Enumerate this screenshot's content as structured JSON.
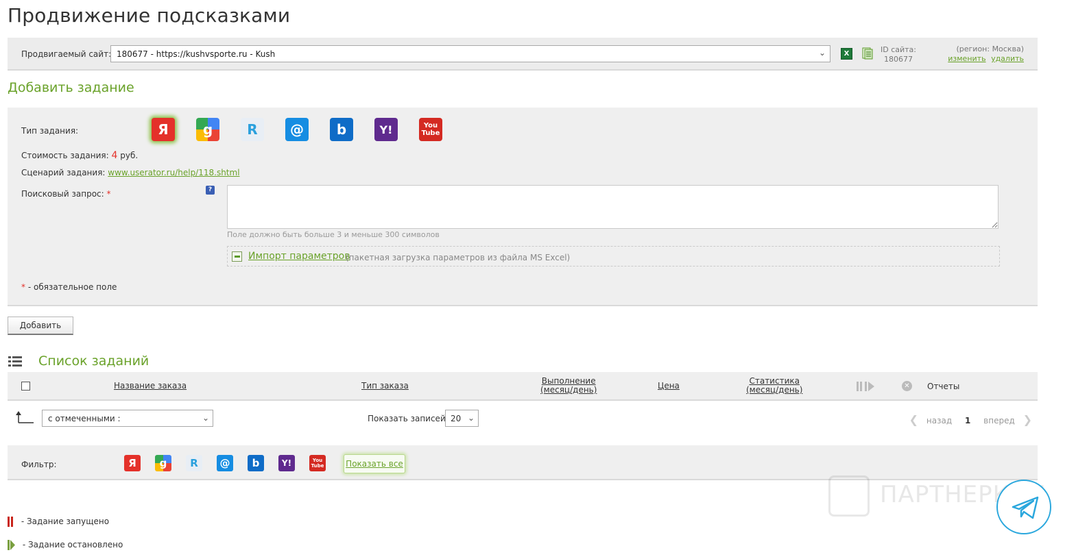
{
  "page": {
    "title": "Продвижение подсказками"
  },
  "site_bar": {
    "label": "Продвигаемый сайт:",
    "selected_site": "180677 - https://kushvsporte.ru - Kush",
    "site_id_label": "ID сайта:",
    "site_id_value": "180677",
    "region_text": "(регион: Москва)",
    "change_link": "изменить",
    "delete_link": "удалить"
  },
  "add_task": {
    "heading": "Добавить задание",
    "type_label": "Тип задания:",
    "types": [
      {
        "name": "yandex-icon",
        "glyph": "Я",
        "selected": true
      },
      {
        "name": "google-icon",
        "glyph": "g",
        "selected": false
      },
      {
        "name": "rambler-icon",
        "glyph": "R",
        "selected": false
      },
      {
        "name": "mailru-icon",
        "glyph": "@",
        "selected": false
      },
      {
        "name": "bing-icon",
        "glyph": "b",
        "selected": false
      },
      {
        "name": "yahoo-icon",
        "glyph": "Y!",
        "selected": false
      },
      {
        "name": "youtube-icon",
        "glyph": "You Tube",
        "selected": false
      }
    ],
    "cost_label": "Стоимость задания:",
    "cost_value": "4",
    "cost_unit": "руб.",
    "scenario_label": "Сценарий задания:",
    "scenario_link": "www.userator.ru/help/118.shtml",
    "query_label": "Поисковый запрос:",
    "required_mark": "*",
    "query_value": "",
    "query_hint": "Поле должно быть больше 3 и меньше 300 символов",
    "import_link": "Импорт параметров",
    "import_note": "(пакетная загрузка параметров из файла MS Excel)",
    "required_note": "- обязательное поле",
    "help_glyph": "?",
    "add_button": "Добавить"
  },
  "task_list": {
    "heading": "Список заданий",
    "columns": [
      {
        "line1": "Название заказа",
        "line2": ""
      },
      {
        "line1": "Тип заказа",
        "line2": ""
      },
      {
        "line1": "Выполнение",
        "line2": "(месяц/день)"
      },
      {
        "line1": "Цена",
        "line2": ""
      },
      {
        "line1": "Статистика",
        "line2": "(месяц/день)"
      }
    ],
    "reports_header": "Отчеты",
    "bulk_action": "с отмеченными :",
    "show_label": "Показать записей:",
    "per_page": "20",
    "pager": {
      "prev": "назад",
      "current": "1",
      "next": "вперед"
    }
  },
  "filter": {
    "label": "Фильтр:",
    "show_all": "Показать все"
  },
  "legend": {
    "running": "- Задание запущено",
    "stopped": "- Задание остановлено"
  },
  "watermark": {
    "text": "ПАРТНЕРКИН"
  },
  "colors": {
    "accent_green": "#6aa22a",
    "required_red": "#e4312a",
    "panel_bg": "#efefef"
  }
}
